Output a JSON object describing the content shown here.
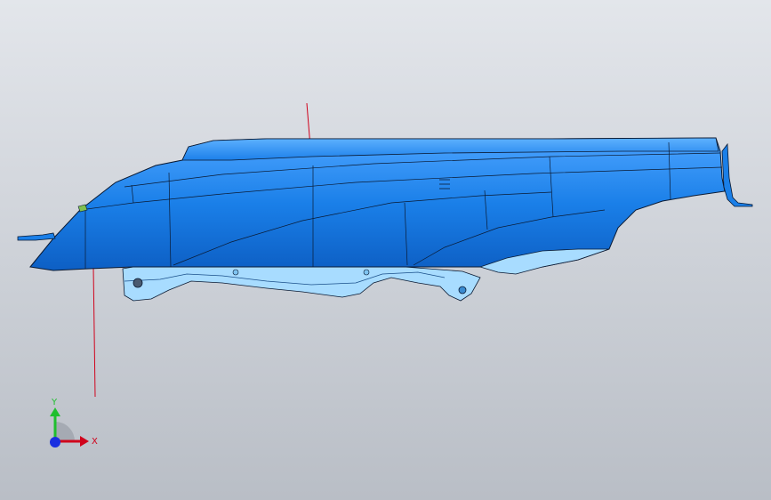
{
  "viewport": {
    "background_top": "#e3e6eb",
    "background_bottom": "#b9bec6"
  },
  "model": {
    "part_color": "#1a7fe8",
    "part_shadow_color": "#0d5fc4",
    "part_highlight_color": "#4aa3ff",
    "bracket_color": "#a8dcff",
    "edge_color": "#0a1a33",
    "axis_line_color": "#d0021b"
  },
  "triad": {
    "x_label": "X",
    "y_label": "Y",
    "x_color": "#d0021b",
    "y_color": "#1fbf2e",
    "z_color": "#1a2fe0"
  }
}
